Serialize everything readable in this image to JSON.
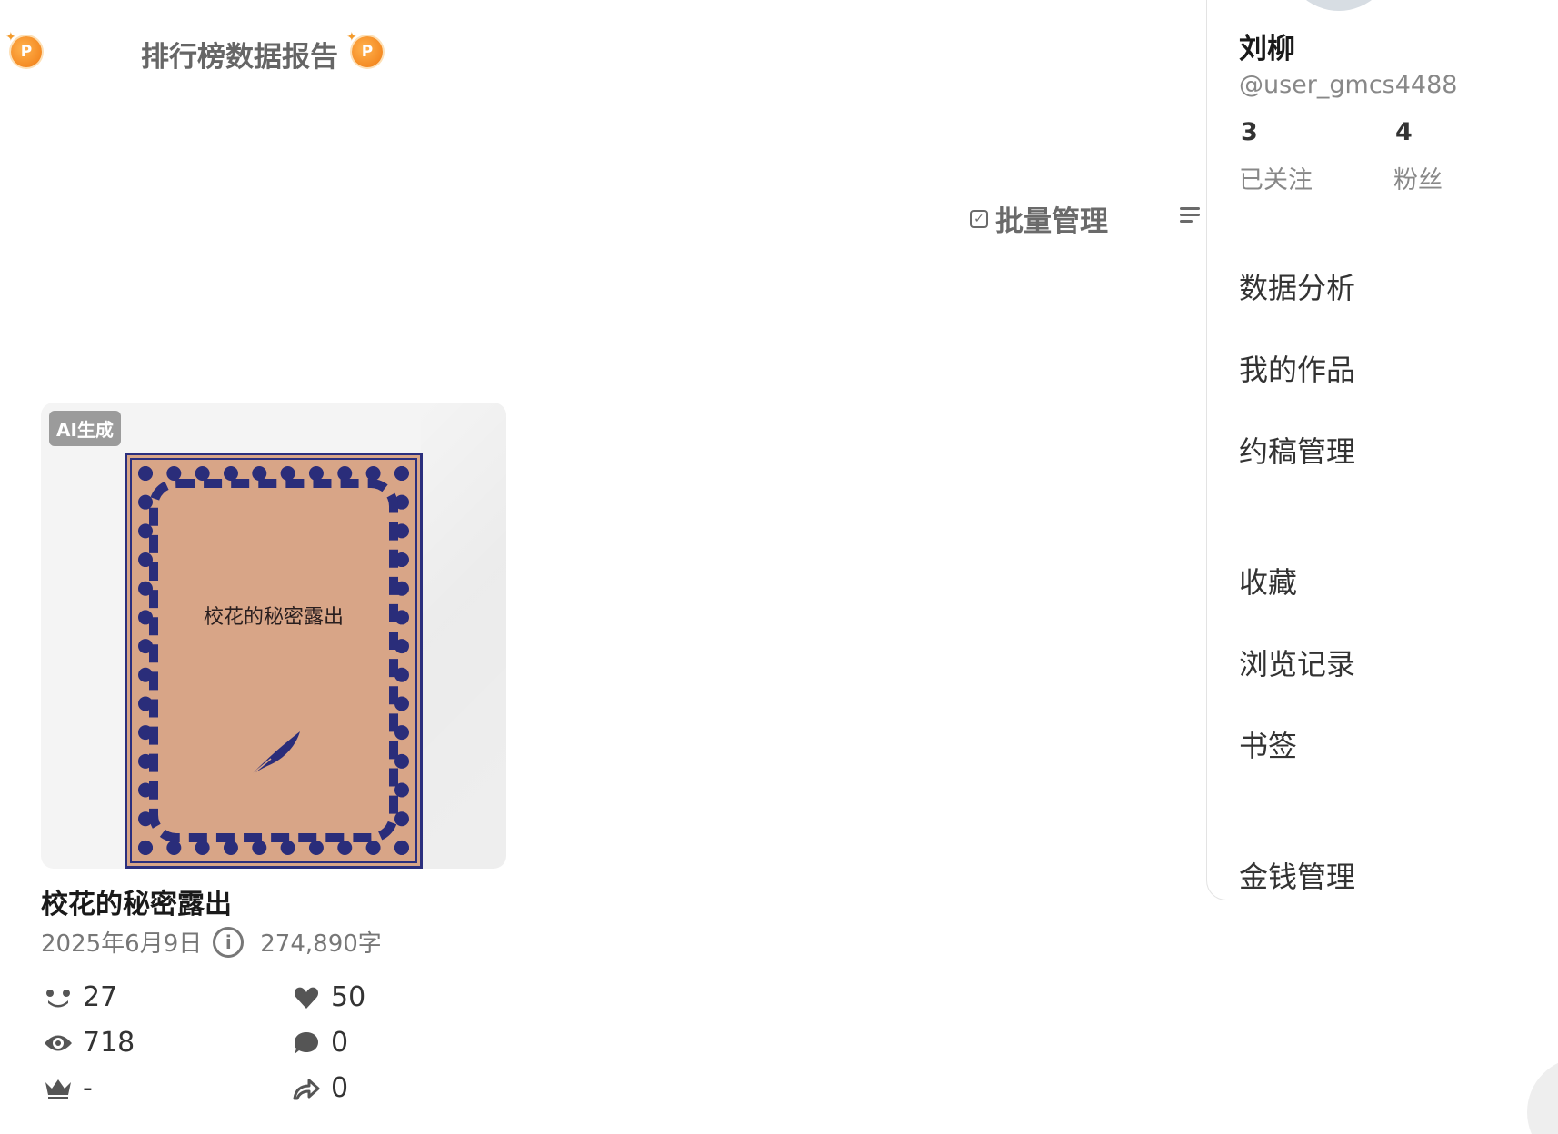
{
  "header": {
    "report_title": "排行榜数据报告",
    "coin_letter": "P"
  },
  "toolbar": {
    "batch_label": "批量管理"
  },
  "work": {
    "badge": "AI生成",
    "cover_title": "校花的秘密露出",
    "title": "校花的秘密露出",
    "date": "2025年6月9日",
    "word_count": "274,890字",
    "stats": {
      "followers": "27",
      "likes": "50",
      "views": "718",
      "comments": "0",
      "rank": "-",
      "shares": "0"
    }
  },
  "profile": {
    "name": "刘柳",
    "handle": "@user_gmcs4488",
    "following_count": "3",
    "following_label": "已关注",
    "fans_count": "4",
    "fans_label": "粉丝"
  },
  "menu": {
    "data_analysis": "数据分析",
    "my_works": "我的作品",
    "commission": "约稿管理",
    "favorites": "收藏",
    "history": "浏览记录",
    "bookmarks": "书签",
    "money": "金钱管理"
  },
  "colors": {
    "coin": "#f07a12",
    "book_cover": "#d8a587",
    "book_ornament": "#2a2d7a",
    "muted_text": "#6a6a6a"
  }
}
